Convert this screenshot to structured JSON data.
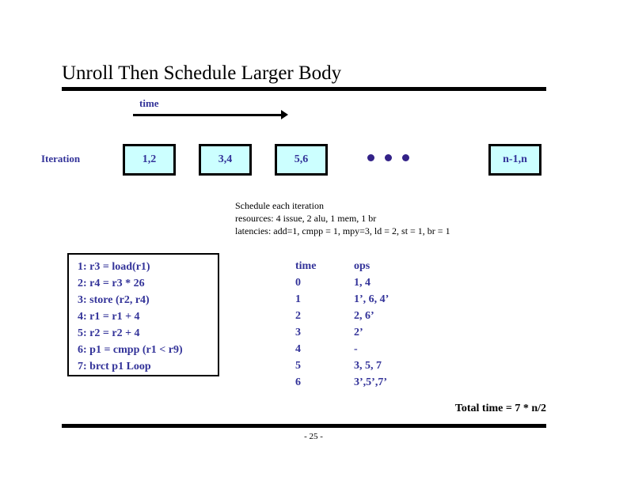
{
  "slide": {
    "title": "Unroll Then Schedule Larger Body",
    "page_number": "- 25 -"
  },
  "axis": {
    "time_label": "time",
    "arrow_icon": "right-arrow-icon"
  },
  "iteration_row": {
    "label": "Iteration",
    "boxes": [
      {
        "label": "1,2"
      },
      {
        "label": "3,4"
      },
      {
        "label": "5,6"
      },
      {
        "label": "n-1,n"
      }
    ],
    "ellipsis_dots": 3,
    "box_fill": "#ccffff",
    "box_border": "#000000",
    "text_color": "#333399"
  },
  "notes": {
    "lines": [
      "Schedule each iteration",
      "resources: 4 issue, 2 alu, 1 mem, 1 br",
      "latencies: add=1, cmpp = 1, mpy=3, ld = 2, st = 1, br = 1"
    ]
  },
  "code": {
    "lines": [
      "1: r3 = load(r1)",
      "2: r4 = r3 * 26",
      "3: store (r2, r4)",
      "4: r1 = r1 + 4",
      "5: r2 = r2 + 4",
      "6: p1 = cmpp (r1 < r9)",
      "7: brct p1 Loop"
    ]
  },
  "schedule": {
    "headers": {
      "time": "time",
      "ops": "ops"
    },
    "rows": [
      {
        "time": "0",
        "ops": "1, 4"
      },
      {
        "time": "1",
        "ops": "1’, 6, 4’"
      },
      {
        "time": "2",
        "ops": "2, 6’"
      },
      {
        "time": "3",
        "ops": "2’"
      },
      {
        "time": "4",
        "ops": "-"
      },
      {
        "time": "5",
        "ops": "3, 5, 7"
      },
      {
        "time": "6",
        "ops": "3’,5’,7’"
      }
    ]
  },
  "total": {
    "text": "Total time = 7 * n/2"
  }
}
